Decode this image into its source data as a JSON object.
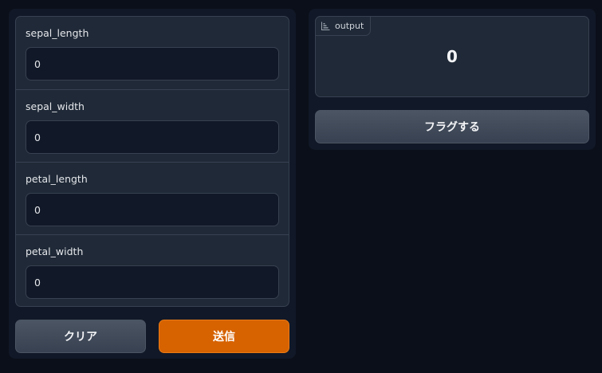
{
  "inputs": [
    {
      "label": "sepal_length",
      "value": "0"
    },
    {
      "label": "sepal_width",
      "value": "0"
    },
    {
      "label": "petal_length",
      "value": "0"
    },
    {
      "label": "petal_width",
      "value": "0"
    }
  ],
  "actions": {
    "clear_label": "クリア",
    "submit_label": "送信"
  },
  "output": {
    "badge_label": "output",
    "badge_icon": "bar-chart-icon",
    "value": "0"
  },
  "flag": {
    "label": "フラグする"
  },
  "colors": {
    "background": "#0b0f19",
    "panel": "#111827",
    "block": "#1f2937",
    "border": "#374151",
    "accent": "#d66200"
  }
}
